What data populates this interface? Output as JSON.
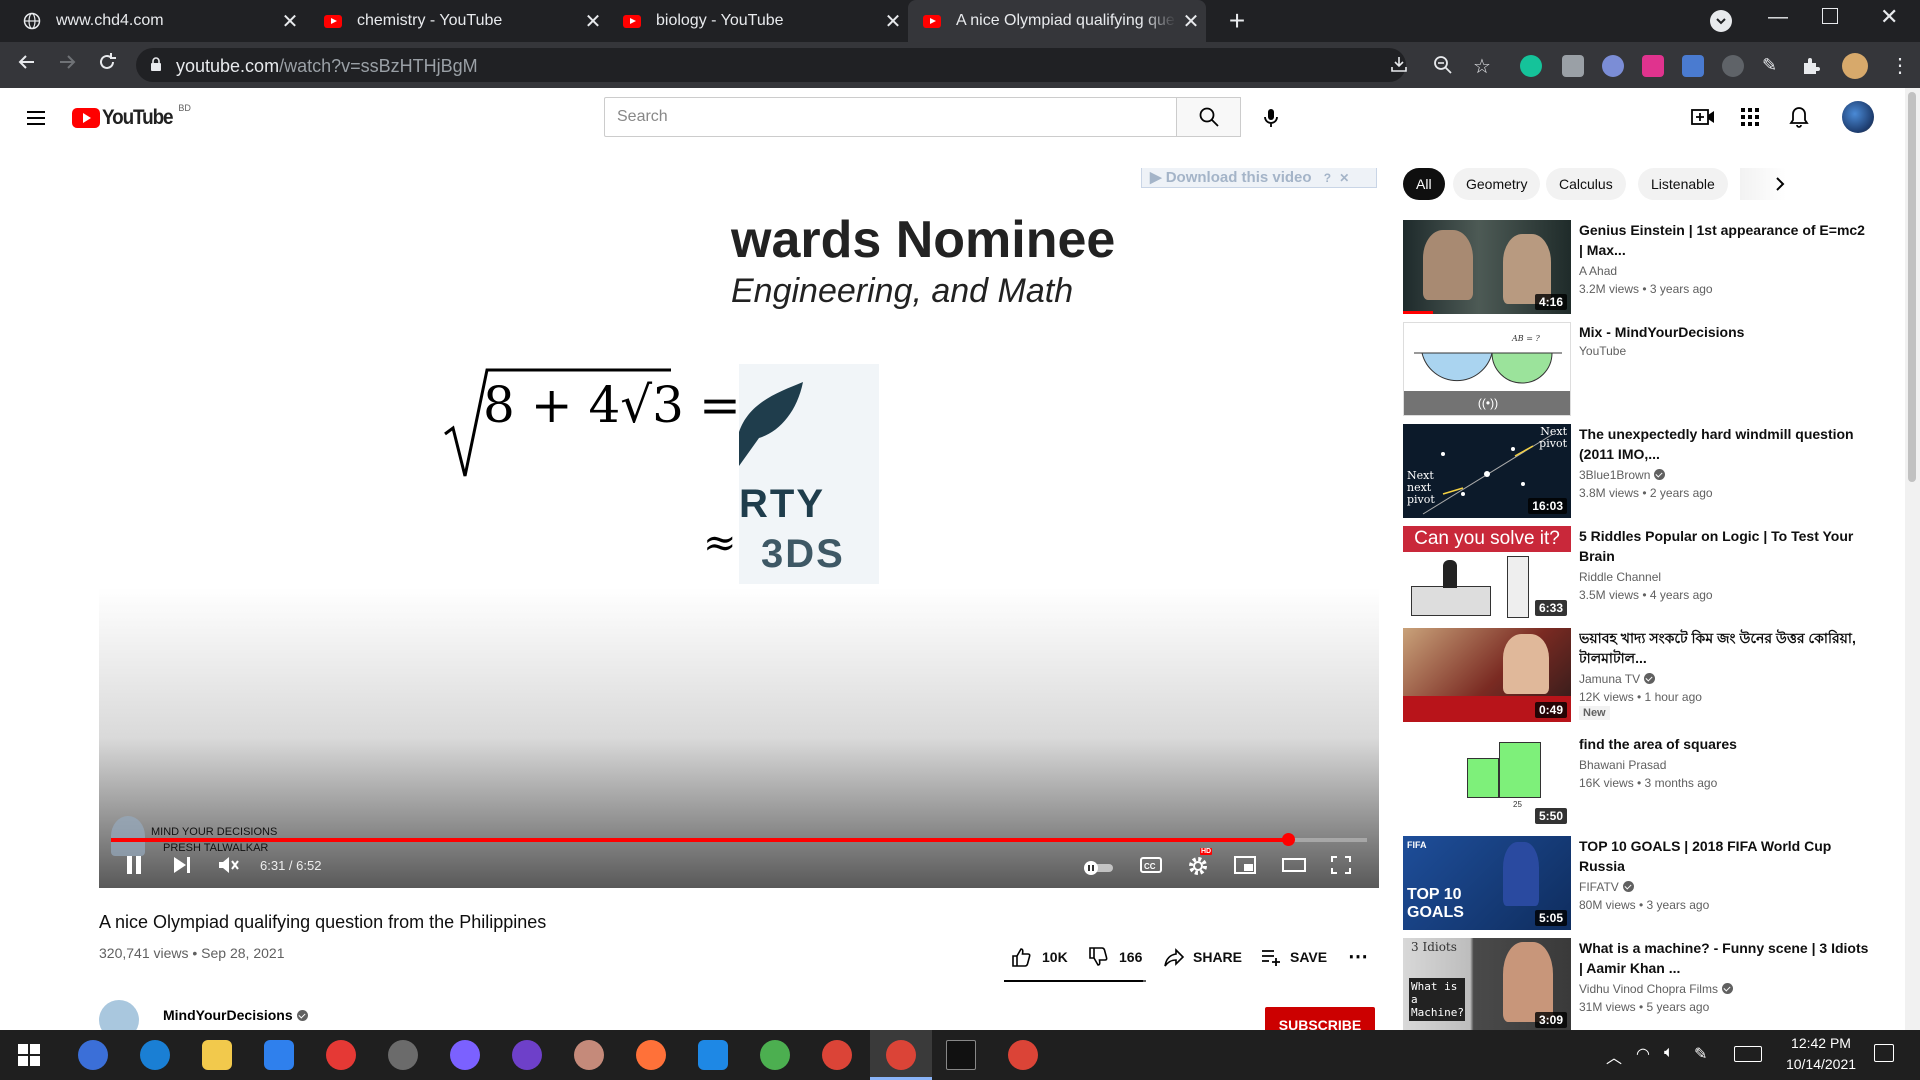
{
  "browser": {
    "tabs": [
      {
        "title": "www.chd4.com",
        "icon": "globe-icon"
      },
      {
        "title": "chemistry - YouTube",
        "icon": "youtube-icon"
      },
      {
        "title": "biology - YouTube",
        "icon": "youtube-icon"
      },
      {
        "title": "A nice Olympiad qualifying quest",
        "icon": "youtube-icon",
        "active": true
      }
    ],
    "url_host": "youtube.com",
    "url_path": "/watch?v=ssBzHTHjBgM"
  },
  "youtube": {
    "logo_text": "YouTube",
    "region": "BD",
    "search_placeholder": "Search"
  },
  "video": {
    "overlay_download": "Download this video",
    "slide_title": "wards Nominee",
    "slide_subtitle": "Engineering, and Math",
    "equation_left": "8 + 4√3",
    "equals": "=",
    "approx": "≈",
    "logo_text_1": "RTY",
    "logo_text_2": "3DS",
    "watermark_1": "MIND YOUR DECISIONS",
    "watermark_2": "PRESH TALWALKAR",
    "time": "6:31 / 6:52",
    "progress": 0.9368,
    "hd_badge": "HD",
    "title": "A nice Olympiad qualifying question from the Philippines",
    "views_date": "320,741 views • Sep 28, 2021",
    "likes": "10K",
    "dislikes": "166",
    "share": "SHARE",
    "save": "SAVE",
    "channel": "MindYourDecisions",
    "subscribe": "SUBSCRIBE"
  },
  "chips": [
    "All",
    "Geometry",
    "Calculus",
    "Listenable"
  ],
  "suggestions": [
    {
      "title": "Genius Einstein | 1st appearance of E=mc2 | Max...",
      "channel": "A Ahad",
      "verified": false,
      "meta": "3.2M views • 3 years ago",
      "duration": "4:16",
      "thumb_color": "#2e3b3a"
    },
    {
      "title": "Mix - MindYourDecisions",
      "channel": "YouTube",
      "verified": false,
      "meta": "",
      "duration": "",
      "thumb_color": "#ffffff"
    },
    {
      "title": "The unexpectedly hard windmill question (2011 IMO,...",
      "channel": "3Blue1Brown",
      "verified": true,
      "meta": "3.8M views • 2 years ago",
      "duration": "16:03",
      "thumb_color": "#0b1a2c"
    },
    {
      "title": "5 Riddles Popular on Logic | To Test Your Brain",
      "channel": "Riddle Channel",
      "verified": false,
      "meta": "3.5M views • 4 years ago",
      "duration": "6:33",
      "thumb_color": "#ffffff"
    },
    {
      "title": "ভয়াবহ খাদ্য সংকটে কিম জং উনের উত্তর কোরিয়া, টালমাটাল...",
      "channel": "Jamuna TV",
      "verified": true,
      "meta": "12K views • 1 hour ago",
      "badge": "New",
      "duration": "0:49",
      "thumb_color": "#6b1b1b"
    },
    {
      "title": "find the area of squares",
      "channel": "Bhawani Prasad",
      "verified": false,
      "meta": "16K views • 3 months ago",
      "duration": "5:50",
      "thumb_color": "#ffffff"
    },
    {
      "title": "TOP 10 GOALS | 2018 FIFA World Cup Russia",
      "channel": "FIFATV",
      "verified": true,
      "meta": "80M views • 3 years ago",
      "duration": "5:05",
      "thumb_color": "#1c3f7a"
    },
    {
      "title": "What is a machine? - Funny scene | 3 Idiots | Aamir Khan ...",
      "channel": "Vidhu Vinod Chopra Films",
      "verified": true,
      "meta": "31M views • 5 years ago",
      "duration": "3:09",
      "thumb_color": "#3a3a3a"
    }
  ],
  "thumb_texts": {
    "riddle": "Can you solve it?",
    "fifa_1": "TOP 10",
    "fifa_2": "GOALS",
    "fifa_logo": "FIFA",
    "windmill_1": "Next pivot",
    "windmill_2": "Next next pivot",
    "area_label": "25",
    "mix_label": "AB = ?",
    "idiots_1": "3 Idiots",
    "idiots_2": "What is a Machine?"
  },
  "taskbar": {
    "time": "12:42 PM",
    "date": "10/14/2021"
  },
  "colors": {
    "youtube_red": "#ff0000",
    "chrome_dark": "#202124",
    "chrome_toolbar": "#35363a"
  }
}
